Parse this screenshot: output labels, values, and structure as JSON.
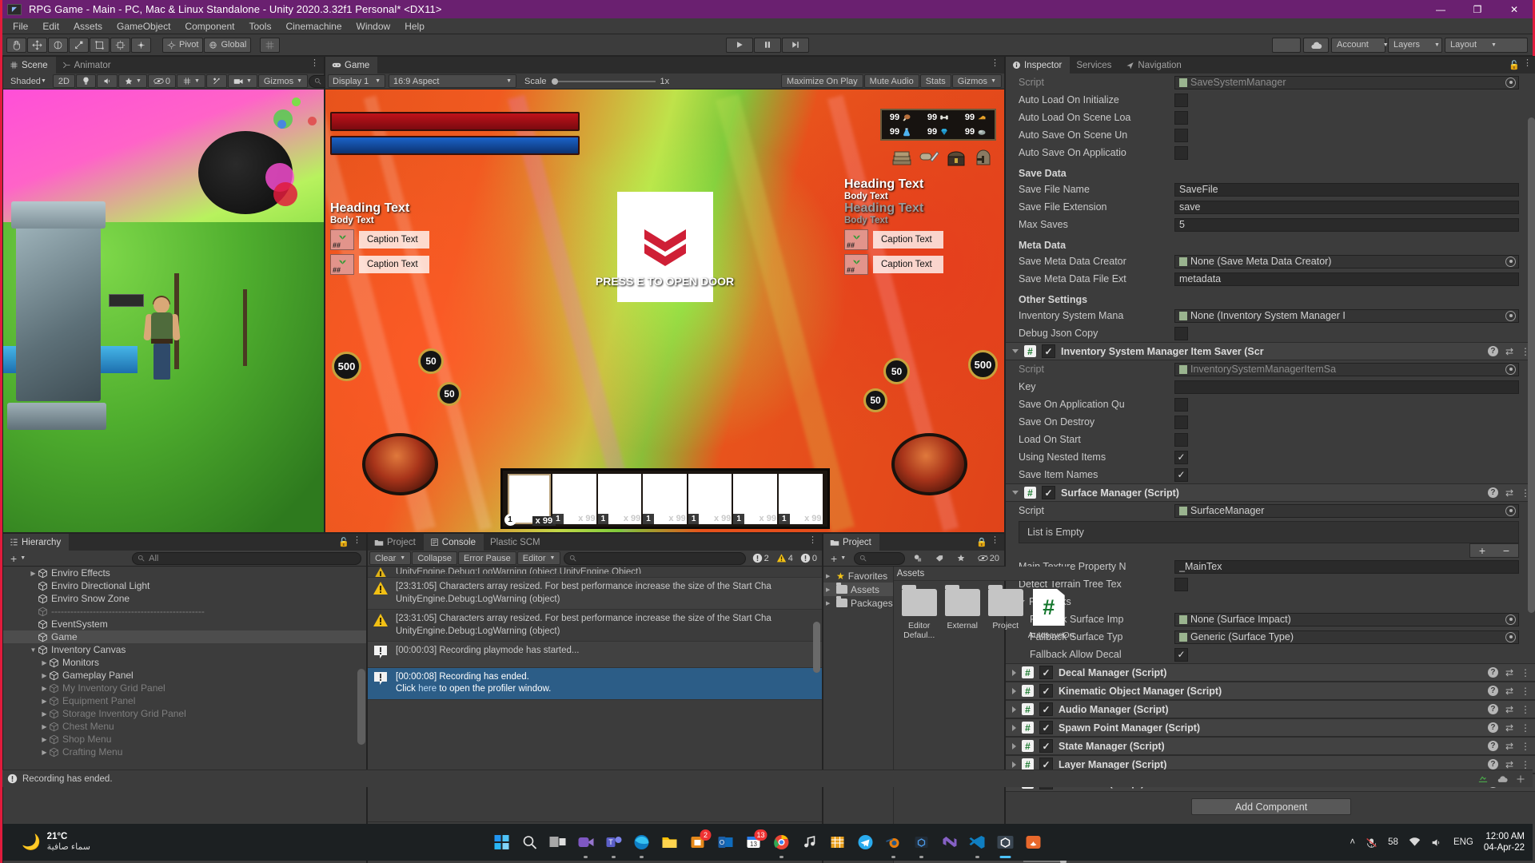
{
  "window": {
    "title": "RPG Game - Main - PC, Mac & Linux Standalone - Unity 2020.3.32f1 Personal* <DX11>",
    "app_icon": "unity-icon",
    "minimize": "—",
    "maximize": "❐",
    "close": "✕"
  },
  "menubar": {
    "items": [
      "File",
      "Edit",
      "Assets",
      "GameObject",
      "Component",
      "Tools",
      "Cinemachine",
      "Window",
      "Help"
    ]
  },
  "toolbar": {
    "transform_tools": [
      "hand-tool",
      "move-tool",
      "rotate-tool",
      "scale-tool",
      "rect-tool",
      "transform-tool",
      "custom-tool"
    ],
    "pivot_label": "Pivot",
    "global_label": "Global",
    "play_label": "▶",
    "pause_label": "Ⅱ",
    "step_label": "▶|",
    "cloud_label": "cloud-icon",
    "account_label": "Account",
    "layers_label": "Layers",
    "layout_label": "Layout"
  },
  "scene": {
    "tabs": [
      {
        "label": "Scene",
        "icon": "grid-icon",
        "active": true
      },
      {
        "label": "Animator",
        "icon": "animator-icon",
        "active": false
      }
    ],
    "shading_mode": "Shaded",
    "mode_2d": "2D",
    "gizmos_label": "Gizmos",
    "hidden_count": "0",
    "search_placeholder": "A",
    "light_icon": "lightbulb-icon",
    "audio_icon": "audio-icon",
    "fx_icon": "effects-icon",
    "grid_icon": "grid-snap-icon",
    "tools_icon": "scene-tools-icon",
    "camera_icon": "camera-icon"
  },
  "game": {
    "tabs": [
      {
        "label": "Game",
        "icon": "gamepad-icon",
        "active": true
      }
    ],
    "display": "Display 1",
    "aspect": "16:9 Aspect",
    "scale_label": "Scale",
    "scale_value": "1x",
    "maximize_on_play": "Maximize On Play",
    "mute_audio": "Mute Audio",
    "stats": "Stats",
    "gizmos": "Gizmos",
    "hud": {
      "resources": [
        {
          "value": "99",
          "icon": "meat-icon"
        },
        {
          "value": "99",
          "icon": "bone-icon"
        },
        {
          "value": "99",
          "icon": "cheese-icon"
        },
        {
          "value": "99",
          "icon": "potion-icon"
        },
        {
          "value": "99",
          "icon": "gem-icon"
        },
        {
          "value": "99",
          "icon": "stone-icon"
        }
      ],
      "equipment_icons": [
        "books-icon",
        "scroll-knife-icon",
        "chest-icon",
        "helmet-icon"
      ],
      "left_panel": {
        "heading": "Heading Text",
        "body": "Body Text",
        "captions": [
          {
            "qty": "##",
            "text": "Caption Text"
          },
          {
            "qty": "##",
            "text": "Caption Text"
          }
        ]
      },
      "right_panel": {
        "heading": "Heading Text",
        "body": "Body Text",
        "heading_dim": "Heading Text",
        "body_dim": "Body Text",
        "captions": [
          {
            "qty": "##",
            "text": "Caption Text"
          },
          {
            "qty": "##",
            "text": "Caption Text"
          }
        ]
      },
      "center_prompt": "PRESS E TO OPEN DOOR",
      "center_card_icon": "chevrons-down-icon",
      "coins_left": [
        "500",
        "50",
        "50"
      ],
      "coins_right": [
        "50",
        "50",
        "500"
      ],
      "hotbar_slots": [
        {
          "index": "1",
          "qty": "x 99",
          "selected": true
        },
        {
          "index": "1",
          "qty": "x 99",
          "selected": false
        },
        {
          "index": "1",
          "qty": "x 99",
          "selected": false
        },
        {
          "index": "1",
          "qty": "x 99",
          "selected": false
        },
        {
          "index": "1",
          "qty": "x 99",
          "selected": false
        },
        {
          "index": "1",
          "qty": "x 99",
          "selected": false
        },
        {
          "index": "1",
          "qty": "x 99",
          "selected": false
        }
      ]
    }
  },
  "inspector": {
    "tabs": [
      {
        "label": "Inspector",
        "icon": "info-icon",
        "active": true
      },
      {
        "label": "Services",
        "icon": "services-icon",
        "active": false
      },
      {
        "label": "Navigation",
        "icon": "navigation-icon",
        "active": false
      }
    ],
    "rows_top": [
      {
        "label": "Script",
        "value": "SaveSystemManager",
        "type": "object",
        "dim": true
      },
      {
        "label": "Auto Load On Initialize",
        "type": "checkbox",
        "checked": false
      },
      {
        "label": "Auto Load On Scene Loa",
        "type": "checkbox",
        "checked": false
      },
      {
        "label": "Auto Save On Scene Un",
        "type": "checkbox",
        "checked": false
      },
      {
        "label": "Auto Save On Applicatio",
        "type": "checkbox",
        "checked": false
      }
    ],
    "section_save_data": "Save Data",
    "rows_save": [
      {
        "label": "Save File Name",
        "value": "SaveFile",
        "type": "text"
      },
      {
        "label": "Save File Extension",
        "value": "save",
        "type": "text"
      },
      {
        "label": "Max Saves",
        "value": "5",
        "type": "text"
      }
    ],
    "section_meta": "Meta Data",
    "rows_meta": [
      {
        "label": "Save Meta Data Creator",
        "value": "None (Save Meta Data Creator)",
        "type": "object"
      },
      {
        "label": "Save Meta Data File Ext",
        "value": "metadata",
        "type": "text"
      }
    ],
    "section_other": "Other Settings",
    "rows_other": [
      {
        "label": "Inventory System Mana",
        "value": "None (Inventory System Manager I",
        "type": "object"
      },
      {
        "label": "Debug Json Copy",
        "type": "checkbox",
        "checked": false
      }
    ],
    "component_item_saver": {
      "title": "Inventory System Manager Item Saver (Scr",
      "enabled": true,
      "rows": [
        {
          "label": "Script",
          "value": "InventorySystemManagerItemSa",
          "type": "object",
          "dim": true
        },
        {
          "label": "Key",
          "value": "",
          "type": "text"
        },
        {
          "label": "Save On Application Qu",
          "type": "checkbox",
          "checked": false
        },
        {
          "label": "Save On Destroy",
          "type": "checkbox",
          "checked": false
        },
        {
          "label": "Load On Start",
          "type": "checkbox",
          "checked": false
        },
        {
          "label": "Using Nested Items",
          "type": "checkbox",
          "checked": true
        },
        {
          "label": "Save Item Names",
          "type": "checkbox",
          "checked": true
        }
      ]
    },
    "component_surface": {
      "title": "Surface Manager (Script)",
      "enabled": true,
      "script_row": {
        "label": "Script",
        "value": "SurfaceManager",
        "type": "object"
      },
      "list_empty": "List is Empty",
      "add_btn": "+",
      "remove_btn": "−",
      "rows": [
        {
          "label": "Main Texture Property N",
          "value": "_MainTex",
          "type": "text"
        },
        {
          "label": "Detect Terrain Tree Tex",
          "type": "checkbox",
          "checked": false
        }
      ],
      "fallbacks_label": "Fallbacks",
      "fallback_rows": [
        {
          "label": "Fallback Surface Imp",
          "value": "None (Surface Impact)",
          "type": "object"
        },
        {
          "label": "Fallback Surface Typ",
          "value": "Generic (Surface Type)",
          "type": "object"
        },
        {
          "label": "Fallback Allow Decal",
          "type": "checkbox",
          "checked": true
        }
      ]
    },
    "collapsed_components": [
      {
        "title": "Decal Manager (Script)",
        "enabled": true
      },
      {
        "title": "Kinematic Object Manager (Script)",
        "enabled": true
      },
      {
        "title": "Audio Manager (Script)",
        "enabled": true
      },
      {
        "title": "Spawn Point Manager (Script)",
        "enabled": true
      },
      {
        "title": "State Manager (Script)",
        "enabled": true
      },
      {
        "title": "Layer Manager (Script)",
        "enabled": true
      },
      {
        "title": "Set Active (Script)",
        "enabled": false
      }
    ],
    "add_component": "Add Component"
  },
  "hierarchy": {
    "tab_label": "Hierarchy",
    "tab_icon": "hierarchy-icon",
    "add_label": "+",
    "search_placeholder": "All",
    "items": [
      {
        "label": "Enviro Effects",
        "depth": 2,
        "expandable": true,
        "dim": false,
        "selected": false
      },
      {
        "label": "Enviro Directional Light",
        "depth": 2,
        "expandable": false,
        "dim": false,
        "selected": false
      },
      {
        "label": "Enviro Snow Zone",
        "depth": 2,
        "expandable": false,
        "dim": false,
        "selected": false
      },
      {
        "label": "------------------------------------------------",
        "depth": 2,
        "expandable": false,
        "dim": true,
        "selected": false
      },
      {
        "label": "EventSystem",
        "depth": 2,
        "expandable": false,
        "dim": false,
        "selected": false
      },
      {
        "label": "Game",
        "depth": 2,
        "expandable": false,
        "dim": false,
        "selected": true
      },
      {
        "label": "Inventory Canvas",
        "depth": 2,
        "expandable": true,
        "expanded": true,
        "dim": false,
        "selected": false
      },
      {
        "label": "Monitors",
        "depth": 3,
        "expandable": true,
        "dim": false,
        "selected": false
      },
      {
        "label": "Gameplay Panel",
        "depth": 3,
        "expandable": true,
        "dim": false,
        "selected": false
      },
      {
        "label": "My Inventory Grid Panel",
        "depth": 3,
        "expandable": true,
        "dim": true,
        "selected": false
      },
      {
        "label": "Equipment Panel",
        "depth": 3,
        "expandable": true,
        "dim": true,
        "selected": false
      },
      {
        "label": "Storage Inventory Grid Panel",
        "depth": 3,
        "expandable": true,
        "dim": true,
        "selected": false
      },
      {
        "label": "Chest Menu",
        "depth": 3,
        "expandable": true,
        "dim": true,
        "selected": false
      },
      {
        "label": "Shop Menu",
        "depth": 3,
        "expandable": true,
        "dim": true,
        "selected": false
      },
      {
        "label": "Crafting Menu",
        "depth": 3,
        "expandable": true,
        "dim": true,
        "selected": false
      }
    ]
  },
  "console": {
    "tabs": [
      {
        "label": "Project",
        "icon": "folder-icon",
        "active": false
      },
      {
        "label": "Console",
        "icon": "console-icon",
        "active": true
      },
      {
        "label": "Plastic SCM",
        "icon": "plastic-icon",
        "active": false
      }
    ],
    "clear_label": "Clear",
    "collapse_label": "Collapse",
    "error_pause_label": "Error Pause",
    "editor_label": "Editor",
    "search_placeholder": "",
    "counts": {
      "error": "2",
      "warning": "4",
      "info": "0"
    },
    "logs": [
      {
        "type": "warning",
        "line1": "UnityEngine.Debug:LogWarning (object,UnityEngine.Object)",
        "line2": "",
        "clipped": true
      },
      {
        "type": "warning",
        "line1": "[23:31:05] Characters array resized. For best performance increase the size of the Start Cha",
        "line2": "UnityEngine.Debug:LogWarning (object)"
      },
      {
        "type": "warning",
        "line1": "[23:31:05] Characters array resized. For best performance increase the size of the Start Cha",
        "line2": "UnityEngine.Debug:LogWarning (object)"
      },
      {
        "type": "info",
        "line1": "[00:00:03] Recording playmode has started...",
        "line2": ""
      },
      {
        "type": "info",
        "line1": "[00:00:08] Recording has ended.",
        "line2": "Click here to open the profiler window.",
        "link": "here",
        "selected": true
      }
    ],
    "detail_line1": "Recording has ended.",
    "detail_line2_pre": "Click ",
    "detail_link": "here",
    "detail_line2_post": " to open the profiler window."
  },
  "project": {
    "tab_label": "Project",
    "tab_icon": "folder-icon",
    "search_placeholder": "",
    "hidden_count": "20",
    "tree": [
      {
        "label": "Favorites",
        "icon": "star-icon",
        "selected": false
      },
      {
        "label": "Assets",
        "icon": "folder-icon",
        "selected": true
      },
      {
        "label": "Packages",
        "icon": "folder-icon",
        "selected": false
      }
    ],
    "breadcrumb": "Assets",
    "assets": [
      {
        "name": "Editor Defaul...",
        "type": "folder"
      },
      {
        "name": "External",
        "type": "folder"
      },
      {
        "name": "Project",
        "type": "folder"
      },
      {
        "name": "AutosaveOn...",
        "type": "csharp"
      }
    ]
  },
  "statusbar": {
    "message": "Recording has ended.",
    "icon": "info-icon"
  },
  "taskbar": {
    "weather_temp": "21°C",
    "weather_desc": "سماء صافية",
    "weather_icon": "moon-icon",
    "apps": [
      {
        "name": "start-icon",
        "badge": ""
      },
      {
        "name": "search-icon",
        "badge": ""
      },
      {
        "name": "task-view-icon",
        "badge": ""
      },
      {
        "name": "meet-icon",
        "badge": ""
      },
      {
        "name": "teams-icon",
        "badge": ""
      },
      {
        "name": "edge-icon",
        "badge": ""
      },
      {
        "name": "explorer-icon",
        "badge": ""
      },
      {
        "name": "store-icon",
        "badge": "2"
      },
      {
        "name": "outlook-icon",
        "badge": ""
      },
      {
        "name": "calendar-icon",
        "badge": "13"
      },
      {
        "name": "chrome-icon",
        "badge": ""
      },
      {
        "name": "music-icon",
        "badge": ""
      },
      {
        "name": "grid-app-icon",
        "badge": ""
      },
      {
        "name": "telegram-icon",
        "badge": ""
      },
      {
        "name": "blender-icon",
        "badge": ""
      },
      {
        "name": "unity-hub-icon",
        "badge": ""
      },
      {
        "name": "vs-icon",
        "badge": ""
      },
      {
        "name": "vscode-icon",
        "badge": ""
      },
      {
        "name": "unity-icon",
        "badge": ""
      },
      {
        "name": "substance-icon",
        "badge": ""
      }
    ],
    "tray": {
      "chevron": "˄",
      "count": "58",
      "lang": "ENG",
      "time": "12:00 AM",
      "date": "04-Apr-22"
    }
  }
}
